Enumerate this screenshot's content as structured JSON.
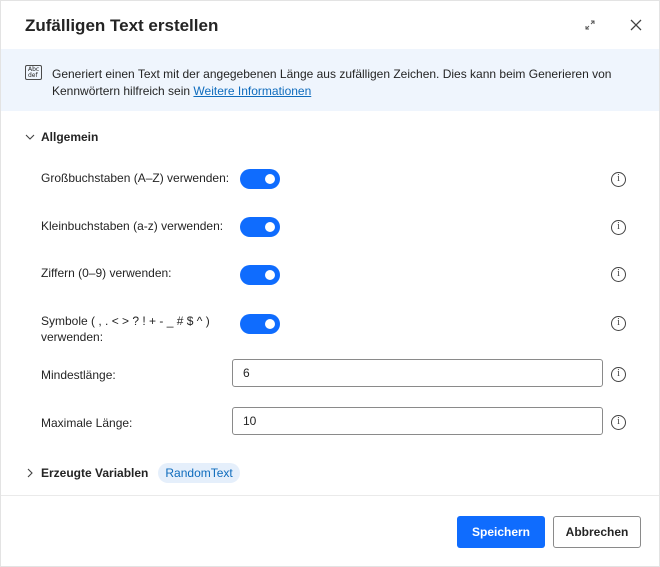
{
  "dialog": {
    "title": "Zufälligen Text erstellen"
  },
  "info": {
    "icon_text": "Abc def",
    "description": "Generiert einen Text mit der angegebenen Länge aus zufälligen Zeichen. Dies kann beim Generieren von Kennwörtern hilfreich sein",
    "link_label": "Weitere Informationen"
  },
  "section": {
    "label": "Allgemein"
  },
  "rows": {
    "uppercase": {
      "label": "Großbuchstaben (A–Z) verwenden:",
      "enabled": true
    },
    "lowercase": {
      "label": "Kleinbuchstaben (a-z) verwenden:",
      "enabled": true
    },
    "digits": {
      "label": "Ziffern (0–9) verwenden:",
      "enabled": true
    },
    "symbols": {
      "label_line1": "Symbole ( , . < > ? ! + - _ # $ ^ )",
      "label_line2": "verwenden:",
      "enabled": true
    },
    "min_length": {
      "label": "Mindestlänge:",
      "value": "6"
    },
    "max_length": {
      "label": "Maximale Länge:",
      "value": "10"
    }
  },
  "variables": {
    "label": "Erzeugte Variablen",
    "chip": "RandomText"
  },
  "buttons": {
    "save": "Speichern",
    "cancel": "Abbrechen"
  },
  "colors": {
    "accent": "#0f6cfe",
    "banner_bg": "#eff5fd",
    "link": "#0f6cbd"
  }
}
